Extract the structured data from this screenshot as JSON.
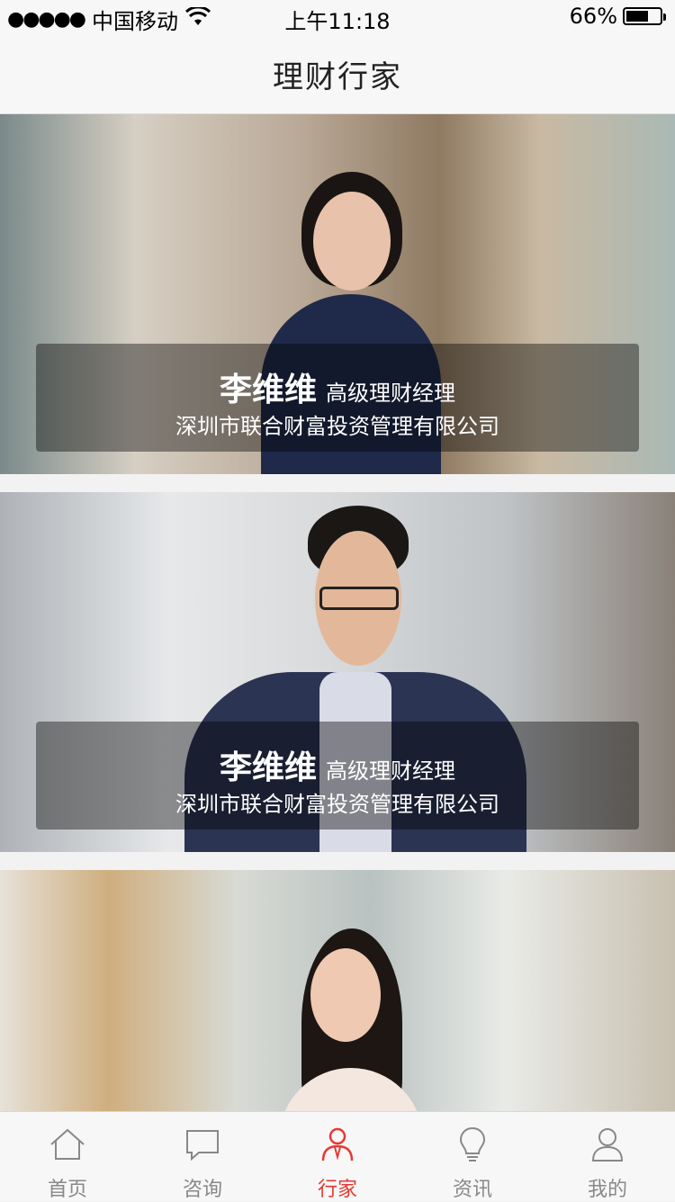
{
  "status_bar": {
    "signal_dots": "●●●●●",
    "carrier": "中国移动",
    "wifi_icon": "wifi-icon",
    "time": "上午11:18",
    "battery_percent": "66%",
    "battery_level": 0.66
  },
  "navbar": {
    "title": "理财行家"
  },
  "advisors": [
    {
      "name": "李维维",
      "role": "高级理财经理",
      "company": "深圳市联合财富投资管理有限公司"
    },
    {
      "name": "李维维",
      "role": "高级理财经理",
      "company": "深圳市联合财富投资管理有限公司"
    },
    {
      "name": "",
      "role": "",
      "company": ""
    }
  ],
  "tabbar": {
    "items": [
      {
        "label": "首页",
        "icon": "home-icon",
        "active": false
      },
      {
        "label": "咨询",
        "icon": "chat-icon",
        "active": false
      },
      {
        "label": "行家",
        "icon": "advisor-icon",
        "active": true
      },
      {
        "label": "资讯",
        "icon": "bulb-icon",
        "active": false
      },
      {
        "label": "我的",
        "icon": "user-icon",
        "active": false
      }
    ]
  },
  "colors": {
    "accent": "#e53935",
    "page_bg": "#f2f2f2",
    "overlay": "rgba(0,0,0,0.4)",
    "tab_inactive": "#888888"
  }
}
